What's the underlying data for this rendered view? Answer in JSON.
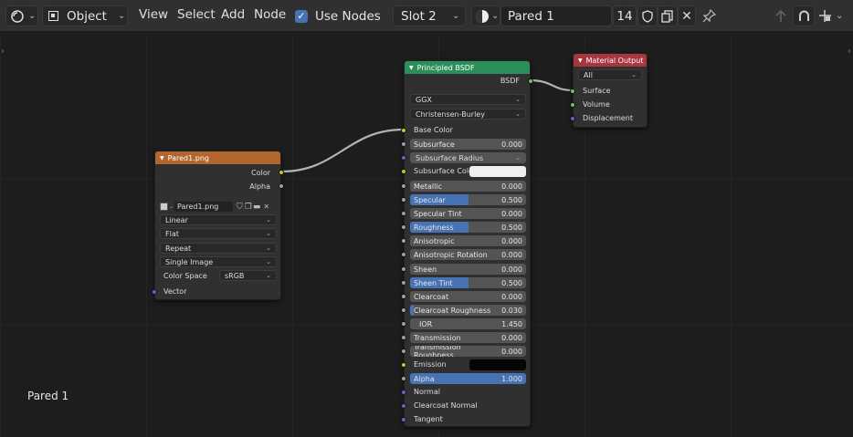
{
  "header": {
    "mode": "Object",
    "menus": [
      "View",
      "Select",
      "Add",
      "Node"
    ],
    "use_nodes_label": "Use Nodes",
    "use_nodes_checked": true,
    "slot": "Slot 2",
    "material_name": "Pared 1",
    "users_count": "14"
  },
  "canvas_label": "Pared 1",
  "image_node": {
    "title": "Pared1.png",
    "outputs": [
      "Color",
      "Alpha"
    ],
    "image_name": "Pared1.png",
    "interpolation": "Linear",
    "projection": "Flat",
    "extension": "Repeat",
    "source": "Single Image",
    "color_space_label": "Color Space",
    "color_space": "sRGB",
    "input": "Vector"
  },
  "bsdf_node": {
    "title": "Principled BSDF",
    "output": "BSDF",
    "distribution": "GGX",
    "subsurface_method": "Christensen-Burley",
    "base_color_label": "Base Color",
    "subsurface": {
      "label": "Subsurface",
      "value": "0.000",
      "fill": 0
    },
    "subsurface_radius": "Subsurface Radius",
    "subsurface_color": "Subsurface Color",
    "metallic": {
      "label": "Metallic",
      "value": "0.000",
      "fill": 0
    },
    "specular": {
      "label": "Specular",
      "value": "0.500",
      "fill": 0.5
    },
    "specular_tint": {
      "label": "Specular Tint",
      "value": "0.000",
      "fill": 0
    },
    "roughness": {
      "label": "Roughness",
      "value": "0.500",
      "fill": 0.5
    },
    "anisotropic": {
      "label": "Anisotropic",
      "value": "0.000",
      "fill": 0
    },
    "anisotropic_rotation": {
      "label": "Anisotropic Rotation",
      "value": "0.000",
      "fill": 0
    },
    "sheen": {
      "label": "Sheen",
      "value": "0.000",
      "fill": 0
    },
    "sheen_tint": {
      "label": "Sheen Tint",
      "value": "0.500",
      "fill": 0.5
    },
    "clearcoat": {
      "label": "Clearcoat",
      "value": "0.000",
      "fill": 0
    },
    "clearcoat_roughness": {
      "label": "Clearcoat Roughness",
      "value": "0.030",
      "fill": 0.03
    },
    "ior": {
      "label": "IOR",
      "value": "1.450"
    },
    "transmission": {
      "label": "Transmission",
      "value": "0.000",
      "fill": 0
    },
    "transmission_roughness": {
      "label": "Transmission Roughness",
      "value": "0.000",
      "fill": 0
    },
    "emission": "Emission",
    "alpha": {
      "label": "Alpha",
      "value": "1.000",
      "fill": 1
    },
    "normal": "Normal",
    "clearcoat_normal": "Clearcoat Normal",
    "tangent": "Tangent"
  },
  "output_node": {
    "title": "Material Output",
    "target": "All",
    "inputs": [
      "Surface",
      "Volume",
      "Displacement"
    ]
  },
  "colors": {
    "bsdf_header": "#2b8f5a",
    "image_header": "#b3652f",
    "output_header": "#a8363e",
    "accent": "#4772b3"
  }
}
